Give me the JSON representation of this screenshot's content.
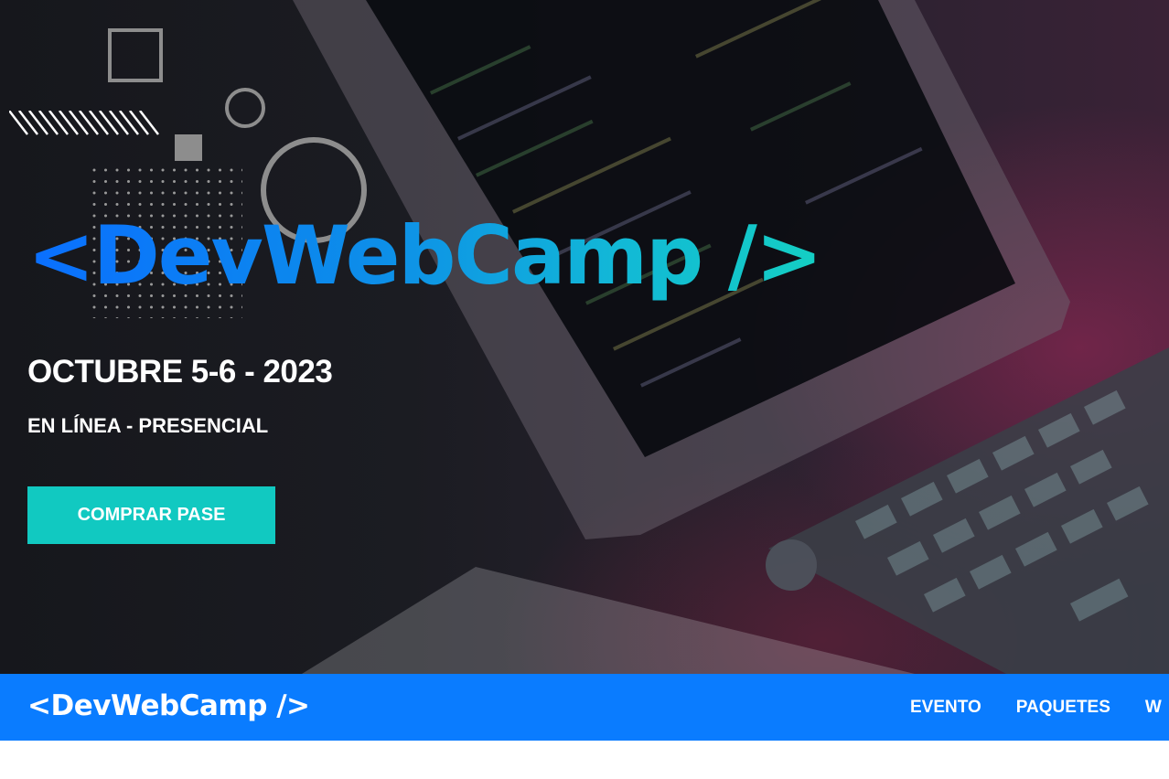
{
  "hero": {
    "logo": "<DevWebCamp />",
    "date": "OCTUBRE 5-6 - 2023",
    "mode": "EN LÍNEA - PRESENCIAL",
    "cta_label": "COMPRAR PASE"
  },
  "navbar": {
    "logo": "<DevWebCamp />",
    "links": [
      "EVENTO",
      "PAQUETES",
      "W"
    ]
  },
  "colors": {
    "brand_blue": "#0a7cff",
    "accent_teal": "#11c9c1",
    "gradient_start": "#0a6fff",
    "gradient_end": "#14cfc3"
  }
}
